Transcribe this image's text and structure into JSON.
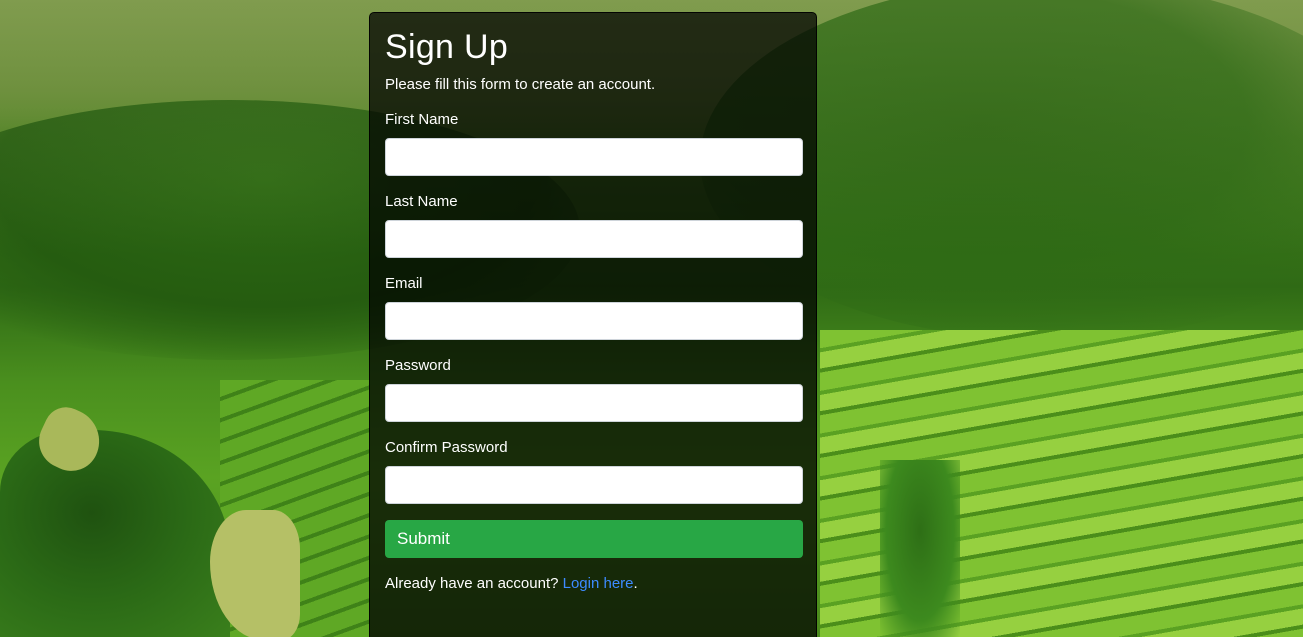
{
  "form": {
    "title": "Sign Up",
    "subtitle": "Please fill this form to create an account.",
    "fields": [
      {
        "label": "First Name",
        "value": "",
        "placeholder": ""
      },
      {
        "label": "Last Name",
        "value": "",
        "placeholder": ""
      },
      {
        "label": "Email",
        "value": "",
        "placeholder": ""
      },
      {
        "label": "Password",
        "value": "",
        "placeholder": ""
      },
      {
        "label": "Confirm Password",
        "value": "",
        "placeholder": ""
      }
    ],
    "submit_label": "Submit",
    "footer_prefix": "Already have an account? ",
    "login_link_label": "Login here",
    "footer_suffix": "."
  },
  "colors": {
    "submit_bg": "#28a745",
    "link": "#3d8bff",
    "panel_bg": "rgba(0,0,0,0.72)"
  },
  "background": {
    "icon": "landscape-background"
  }
}
